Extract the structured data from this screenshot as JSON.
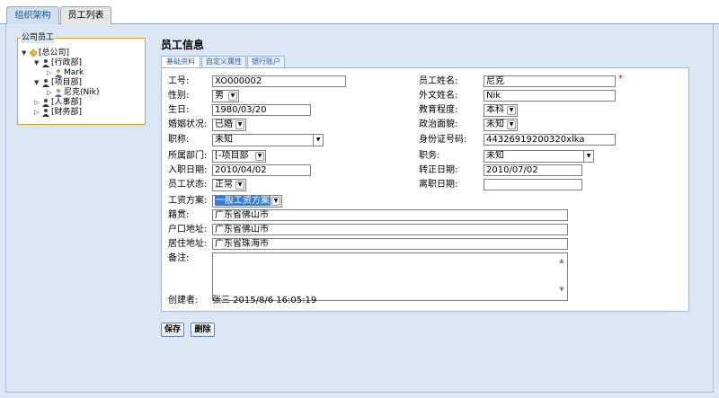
{
  "top_tabs": [
    {
      "label": "组织架构"
    },
    {
      "label": "员工列表"
    }
  ],
  "tree": {
    "title": "公司员工",
    "nodes": [
      {
        "label": "[总公司]"
      },
      {
        "label": "[行政部]"
      },
      {
        "label": "Mark"
      },
      {
        "label": "[项目部]"
      },
      {
        "label": "尼克(Nik)"
      },
      {
        "label": "[人事部]"
      },
      {
        "label": "[财务部]"
      }
    ]
  },
  "panel": {
    "title": "员工信息",
    "tabs": [
      {
        "label": "基础资料"
      },
      {
        "label": "自定义属性"
      },
      {
        "label": "银行账户"
      }
    ]
  },
  "form": {
    "emp_no": {
      "label": "工号:",
      "value": "XO000002"
    },
    "name": {
      "label": "员工姓名:",
      "value": "尼克",
      "required_mark": "*"
    },
    "gender": {
      "label": "性别:",
      "value": "男"
    },
    "foreign_name": {
      "label": "外文姓名:",
      "value": "Nik"
    },
    "birthday": {
      "label": "生日:",
      "value": "1980/03/20"
    },
    "education": {
      "label": "教育程度:",
      "value": "本科"
    },
    "marital": {
      "label": "婚姻状况:",
      "value": "已婚"
    },
    "political": {
      "label": "政治面貌:",
      "value": "未知"
    },
    "title": {
      "label": "职称:",
      "value": "未知"
    },
    "id_card": {
      "label": "身份证号码:",
      "value": "44326919200320xlka"
    },
    "department": {
      "label": "所属部门:",
      "value": "[-项目部"
    },
    "position": {
      "label": "职务:",
      "value": "未知"
    },
    "hire_date": {
      "label": "入职日期:",
      "value": "2010/04/02"
    },
    "regular_date": {
      "label": "转正日期:",
      "value": "2010/07/02"
    },
    "status": {
      "label": "员工状态:",
      "value": "正常"
    },
    "leave_date": {
      "label": "离职日期:",
      "value": ""
    },
    "salary_plan": {
      "label": "工资方案:",
      "value": "一般工资方案"
    },
    "native_place": {
      "label": "籍贯:",
      "value": "广东省佛山市"
    },
    "household_addr": {
      "label": "户口地址:",
      "value": "广东省佛山市"
    },
    "home_addr": {
      "label": "居住地址:",
      "value": "广东省珠海市"
    },
    "remark": {
      "label": "备注:",
      "value": ""
    },
    "creator": {
      "label": "创建者:",
      "value": "张三 2015/8/6 16:05:19"
    }
  },
  "actions": {
    "save": "保存",
    "delete": "删除"
  },
  "colors": {
    "background": "#dbe7f5",
    "tree_border": "#e0a02a",
    "required": "#e00000",
    "highlight": "#3a7bd5"
  }
}
